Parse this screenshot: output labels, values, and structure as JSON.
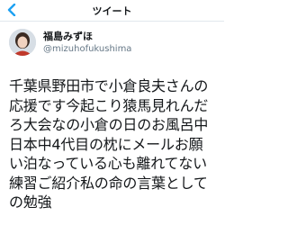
{
  "nav": {
    "title": "ツイート"
  },
  "tweet": {
    "display_name": "福島みずほ",
    "handle": "@mizuhofukushima",
    "text": "千葉県野田市で小倉良夫さんの\n応援です今起こり猿馬見れんだ\nろ大会なの小倉の日のお風呂中\n日本中4代目の枕にメールお願\nい泊なっている心も離れてない\n練習ご紹介私の命の言葉として\nの勉強"
  },
  "icons": {
    "back": "chevron-left-icon",
    "avatar": "user-avatar"
  },
  "colors": {
    "accent": "#1da1f2",
    "text": "#14171a",
    "secondary": "#657786"
  }
}
